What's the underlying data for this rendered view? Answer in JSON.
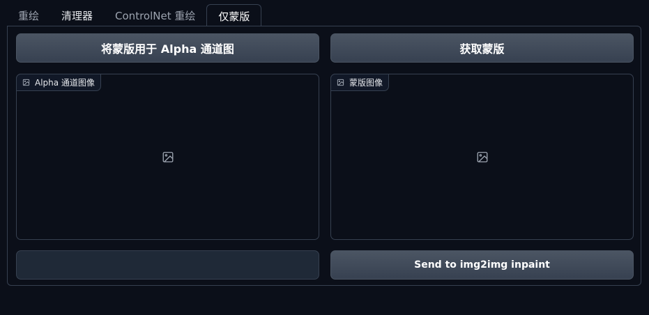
{
  "tabs": [
    {
      "label": "重绘"
    },
    {
      "label": "清理器"
    },
    {
      "label": "ControlNet 重绘"
    },
    {
      "label": "仅蒙版"
    }
  ],
  "left": {
    "apply_button": "将蒙版用于 Alpha 通道图",
    "image_label": "Alpha 通道图像",
    "image_icon": "image-icon",
    "bottom_button": ""
  },
  "right": {
    "get_button": "获取蒙版",
    "image_label": "蒙版图像",
    "image_icon": "image-icon",
    "send_button": "Send to img2img inpaint"
  },
  "colors": {
    "background": "#0b0f19",
    "border": "#374151",
    "button_top": "#4b5563",
    "button_bottom": "#374151"
  }
}
